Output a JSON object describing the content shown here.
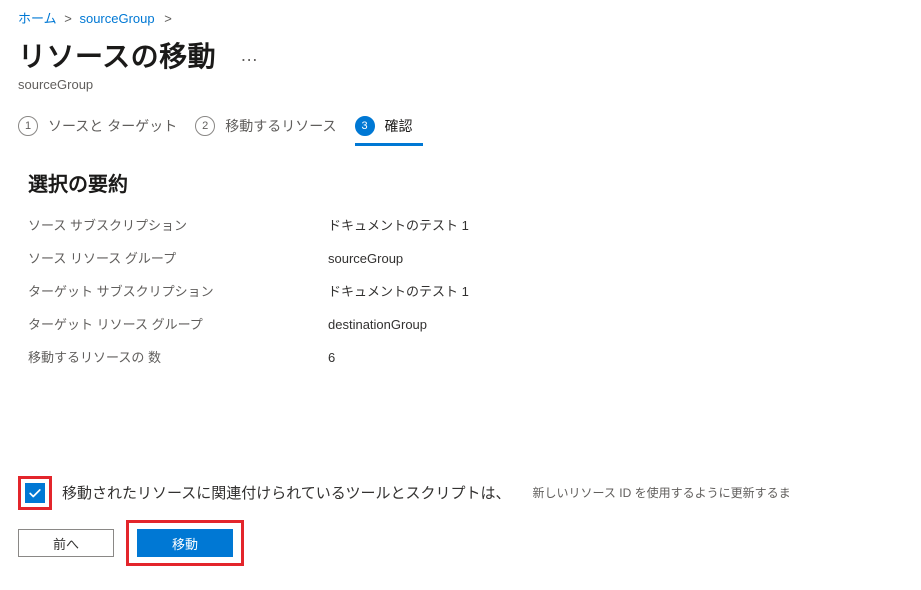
{
  "breadcrumb": {
    "home": "ホーム",
    "sourceGroup": "sourceGroup"
  },
  "page": {
    "title": "リソースの移動",
    "subtitle": "sourceGroup",
    "more": "…"
  },
  "steps": {
    "s1": {
      "num": "1",
      "label": "ソースと ターゲット"
    },
    "s2": {
      "num": "2",
      "label": "移動するリソース"
    },
    "s3": {
      "num": "3",
      "label": "確認"
    }
  },
  "summary": {
    "heading": "選択の要約",
    "rows": {
      "srcSub": {
        "k": "ソース サブスクリプション",
        "v": "ドキュメントのテスト 1"
      },
      "srcRg": {
        "k": "ソース リソース グループ",
        "v": "sourceGroup"
      },
      "tgtSub": {
        "k": "ターゲット サブスクリプション",
        "v": "ドキュメントのテスト 1"
      },
      "tgtRg": {
        "k": "ターゲット リソース グループ",
        "v": "destinationGroup"
      },
      "count": {
        "k": "移動するリソースの 数",
        "v": "6"
      }
    }
  },
  "ack": {
    "text": "移動されたリソースに関連付けられているツールとスクリプトは、",
    "note": "新しいリソース ID を使用するように更新するま"
  },
  "buttons": {
    "prev": "前へ",
    "move": "移動"
  }
}
